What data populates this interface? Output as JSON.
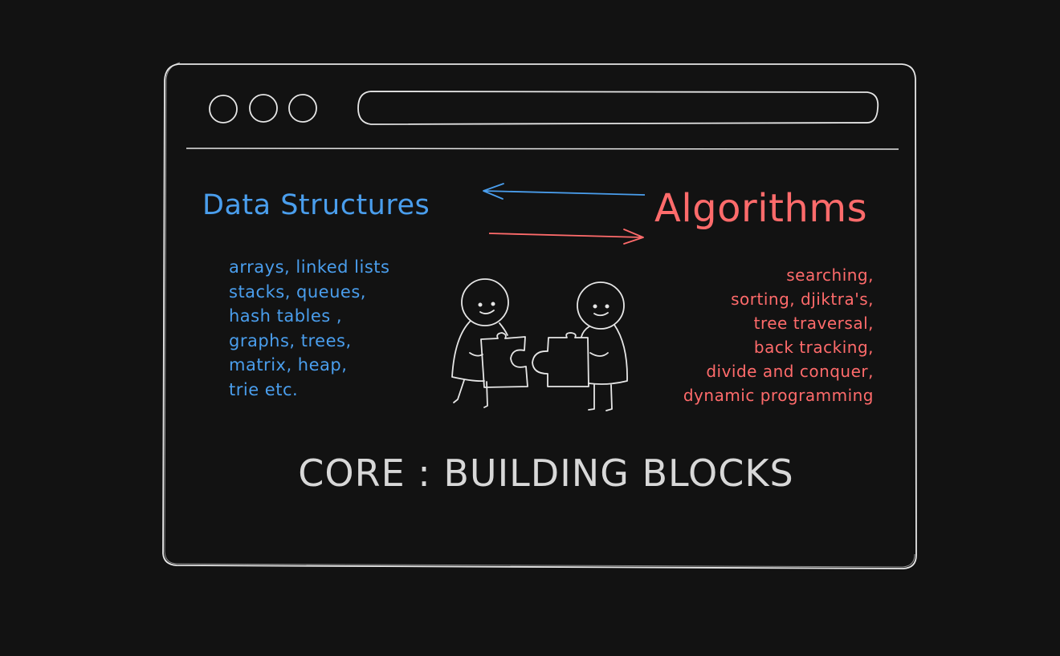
{
  "colors": {
    "background": "#121212",
    "stroke": "#e6e6e6",
    "data_structures": "#4a9eed",
    "algorithms": "#ff6b6b",
    "core_text": "#d8d8d8"
  },
  "browser": {
    "window_buttons": [
      "circle",
      "circle",
      "circle"
    ],
    "address_bar": ""
  },
  "data_structures": {
    "title": "Data Structures",
    "items": [
      "arrays, linked lists",
      "stacks, queues,",
      "hash tables ,",
      "graphs, trees,",
      "matrix, heap,",
      "trie etc."
    ]
  },
  "algorithms": {
    "title": "Algorithms",
    "items": [
      "searching,",
      "sorting, djiktra's,",
      "tree traversal,",
      "back tracking,",
      "divide and conquer,",
      "dynamic programming"
    ]
  },
  "illustration": {
    "icon": "two-people-joining-puzzle-pieces"
  },
  "core": {
    "text": "CORE : BUILDING BLOCKS"
  }
}
